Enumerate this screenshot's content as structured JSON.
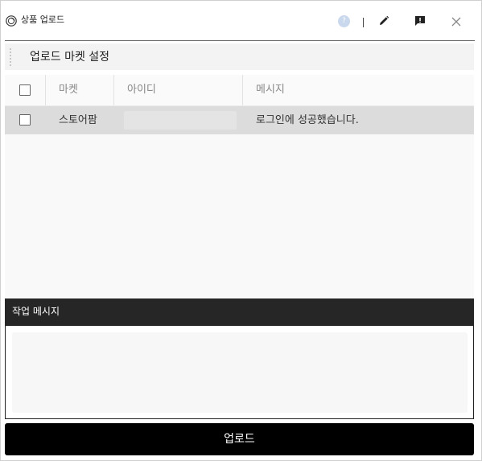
{
  "window": {
    "title": "상품 업로드",
    "help_glyph": "?"
  },
  "section": {
    "title": "업로드 마켓 설정"
  },
  "table": {
    "columns": [
      "마켓",
      "아이디",
      "메시지"
    ],
    "rows": [
      {
        "market": "스토어팜",
        "id": "",
        "message": "로그인에 성공했습니다.",
        "checked": false,
        "selected": true
      }
    ],
    "select_all_checked": false
  },
  "log": {
    "title": "작업 메시지",
    "content": ""
  },
  "actions": {
    "upload_label": "업로드"
  },
  "colors": {
    "log_header_bg": "#262626",
    "button_bg": "#000000",
    "row_selected_bg": "#dcdcdc",
    "help_icon_bg": "#c9d8ec"
  },
  "icons": [
    "app-logo-icon",
    "help-icon",
    "edit-icon",
    "report-icon",
    "close-icon",
    "drag-handle-icon",
    "checkbox-icon"
  ]
}
